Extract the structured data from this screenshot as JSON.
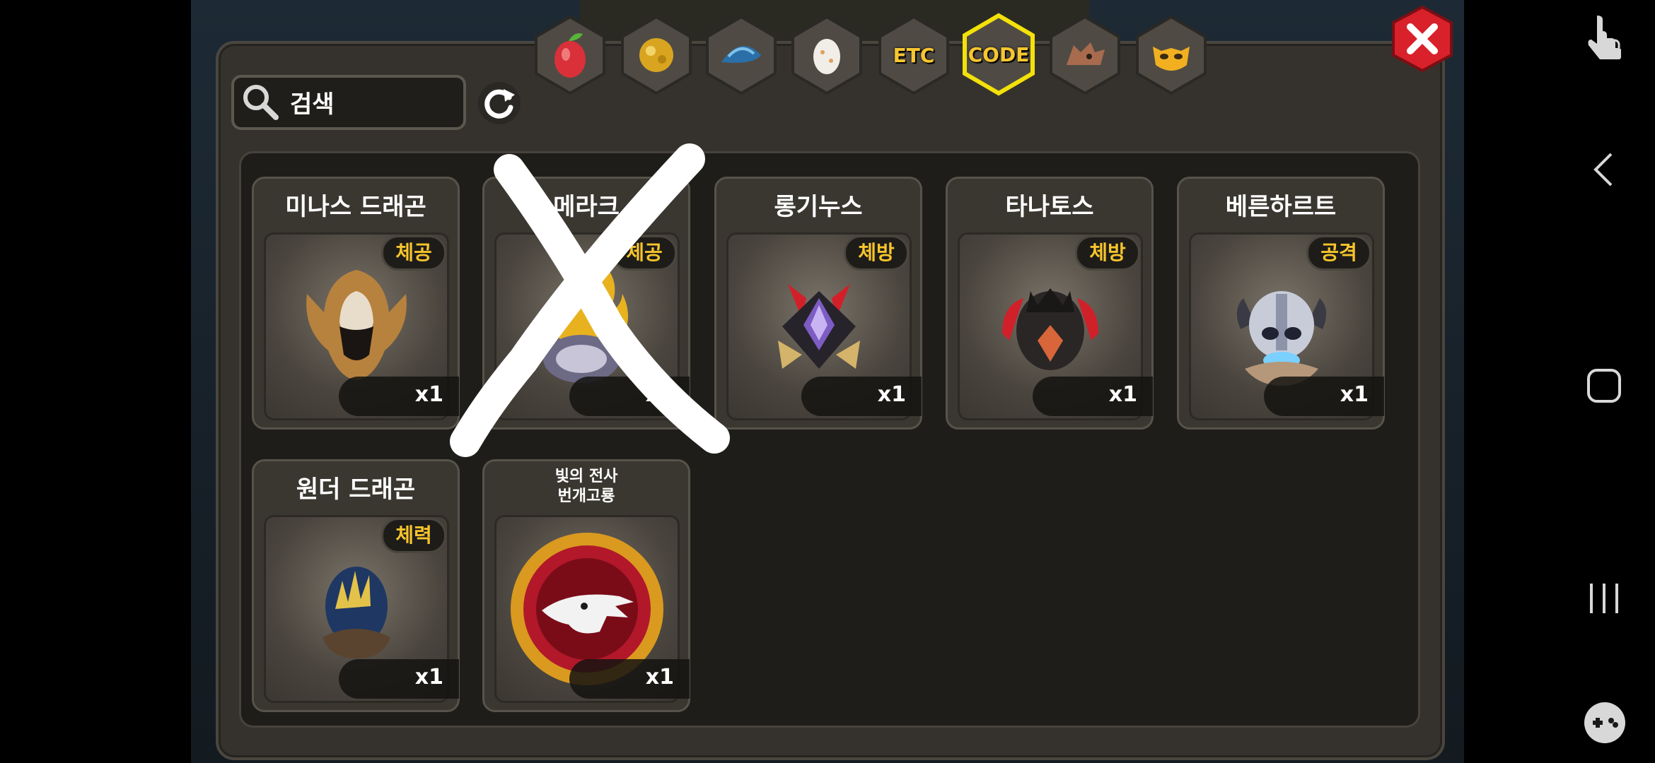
{
  "search": {
    "placeholder": "검색"
  },
  "tabs": [
    {
      "name": "fruit"
    },
    {
      "name": "gold"
    },
    {
      "name": "scale"
    },
    {
      "name": "egg"
    },
    {
      "label": "ETC"
    },
    {
      "label": "CODE",
      "selected": true
    },
    {
      "name": "dragon-head"
    },
    {
      "name": "mask"
    }
  ],
  "cards": [
    {
      "title": "미나스 드래곤",
      "badge": "체공",
      "count": "x1",
      "icon": "winged-helmet"
    },
    {
      "title": "메라크",
      "badge": "체공",
      "count": "x1",
      "icon": "flame-dragon-egg"
    },
    {
      "title": "롱기누스",
      "badge": "체방",
      "count": "x1",
      "icon": "purple-crystal-helm"
    },
    {
      "title": "타나토스",
      "badge": "체방",
      "count": "x1",
      "icon": "dark-spiked-egg"
    },
    {
      "title": "베른하르트",
      "badge": "공격",
      "count": "x1",
      "icon": "viking-helmet-egg"
    },
    {
      "title": "원더 드래곤",
      "badge": "체력",
      "count": "x1",
      "icon": "blue-nest-egg"
    },
    {
      "title_line1": "빛의 전사",
      "title_line2": "번개고룡",
      "count": "x1",
      "icon": "dragon-emblem"
    }
  ],
  "colors": {
    "badge_text": "#f7c52c",
    "tab_selected_border": "#f3e10a",
    "close_red": "#d9212b"
  }
}
